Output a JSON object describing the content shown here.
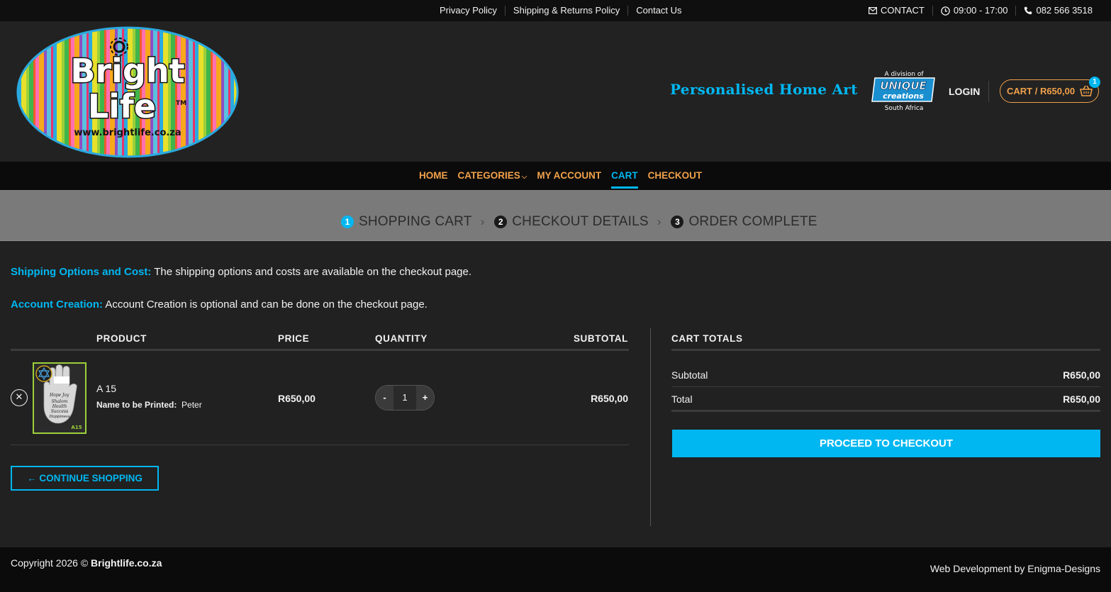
{
  "topbar": {
    "links": [
      "Privacy Policy",
      "Shipping & Returns Policy",
      "Contact Us"
    ],
    "contact_label": "CONTACT",
    "hours": "09:00 - 17:00",
    "phone": "082 566 3518"
  },
  "header": {
    "logo_text": "Bright Life",
    "logo_url": "www.brightlife.co.za",
    "tagline": "Personalised Home Art",
    "division": {
      "top": "A division of",
      "brand1": "UNIQUE",
      "brand2": "creations",
      "bottom": "South Africa"
    },
    "login": "LOGIN",
    "cart_label": "CART / R650,00",
    "cart_count": "1"
  },
  "nav": {
    "items": [
      "HOME",
      "CATEGORIES",
      "MY ACCOUNT",
      "CART",
      "CHECKOUT"
    ],
    "active": "CART"
  },
  "steps": [
    {
      "num": "1",
      "label": "SHOPPING CART"
    },
    {
      "num": "2",
      "label": "CHECKOUT DETAILS"
    },
    {
      "num": "3",
      "label": "ORDER COMPLETE"
    }
  ],
  "notices": {
    "shipping_title": "Shipping Options and Cost:",
    "shipping_text": " The shipping options and costs are available on the checkout page.",
    "account_title": "Account Creation:",
    "account_text": " Account Creation is optional and can be done on the checkout page."
  },
  "cart": {
    "headers": {
      "product": "PRODUCT",
      "price": "PRICE",
      "quantity": "QUANTITY",
      "subtotal": "SUBTOTAL"
    },
    "item": {
      "name": "A 15",
      "variation_label": "Name to be Printed:",
      "variation_value": "Peter",
      "price": "R650,00",
      "quantity": "1",
      "subtotal": "R650,00",
      "thumb_words": [
        "Hope",
        "Joy",
        "Shalom",
        "Health",
        "Success",
        "Happiness"
      ],
      "thumb_code": "A15"
    },
    "qty_minus": "-",
    "qty_plus": "+",
    "continue": "← CONTINUE SHOPPING"
  },
  "totals": {
    "title": "CART TOTALS",
    "subtotal_label": "Subtotal",
    "subtotal_value": "R650,00",
    "total_label": "Total",
    "total_value": "R650,00",
    "proceed": "PROCEED TO CHECKOUT"
  },
  "footer": {
    "copy_prefix": "Copyright 2026 © ",
    "copy_brand": "Brightlife.co.za",
    "dev": "Web Development by Enigma-Designs"
  },
  "colors": {
    "accent": "#00b7f1",
    "nav_link": "#f0a14b",
    "background": "#212121"
  }
}
